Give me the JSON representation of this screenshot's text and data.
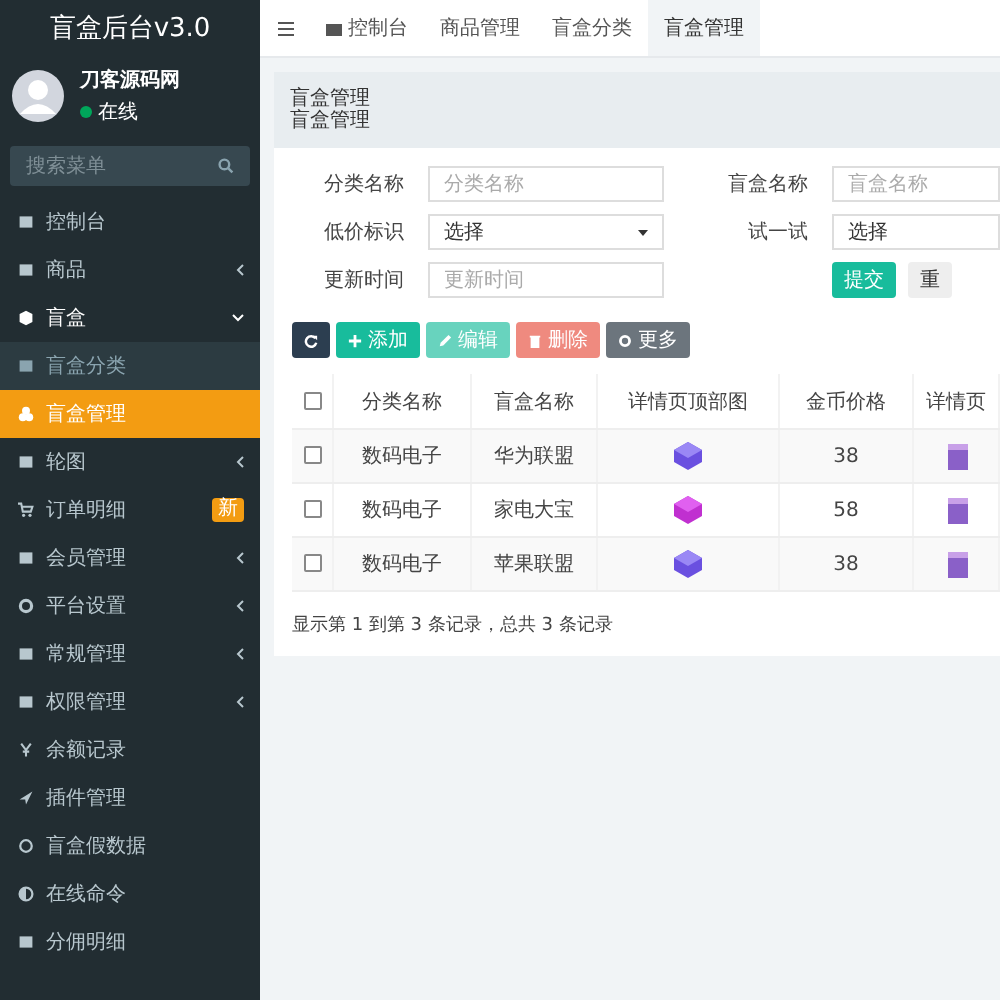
{
  "sidebar": {
    "title": "盲盒后台v3.0",
    "user": {
      "name": "刀客源码网",
      "status": "在线"
    },
    "search": {
      "placeholder": "搜索菜单"
    },
    "items": [
      {
        "label": "控制台",
        "kind": "link",
        "selected": false
      },
      {
        "label": "商品",
        "kind": "group",
        "selected": false,
        "expanded": false
      },
      {
        "label": "盲盒",
        "kind": "group",
        "selected": false,
        "expanded": true,
        "children": [
          {
            "label": "盲盒分类",
            "selected": false
          },
          {
            "label": "盲盒管理",
            "selected": true
          }
        ]
      },
      {
        "label": "轮图",
        "kind": "group",
        "selected": false,
        "expanded": false
      },
      {
        "label": "订单明细",
        "kind": "link",
        "selected": false,
        "badge": "新"
      },
      {
        "label": "会员管理",
        "kind": "group",
        "selected": false,
        "expanded": false
      },
      {
        "label": "平台设置",
        "kind": "group",
        "selected": false,
        "expanded": false
      },
      {
        "label": "常规管理",
        "kind": "group",
        "selected": false,
        "expanded": false
      },
      {
        "label": "权限管理",
        "kind": "group",
        "selected": false,
        "expanded": false
      },
      {
        "label": "余额记录",
        "kind": "link",
        "selected": false
      },
      {
        "label": "插件管理",
        "kind": "link",
        "selected": false
      },
      {
        "label": "盲盒假数据",
        "kind": "link",
        "selected": false
      },
      {
        "label": "在线命令",
        "kind": "link",
        "selected": false
      },
      {
        "label": "分佣明细",
        "kind": "link",
        "selected": false
      }
    ]
  },
  "tabs": [
    {
      "label": "控制台",
      "selected": false
    },
    {
      "label": "商品管理",
      "selected": false
    },
    {
      "label": "盲盒分类",
      "selected": false
    },
    {
      "label": "盲盒管理",
      "selected": true
    }
  ],
  "panel": {
    "title": "盲盒管理",
    "subtitle": "盲盒管理"
  },
  "form": {
    "rows": [
      [
        {
          "label": "分类名称",
          "kind": "input",
          "placeholder": "分类名称"
        },
        {
          "label": "盲盒名称",
          "kind": "input",
          "placeholder": "盲盒名称"
        }
      ],
      [
        {
          "label": "低价标识",
          "kind": "select",
          "value": "选择"
        },
        {
          "label": "试一试",
          "kind": "select",
          "value": "选择"
        }
      ],
      [
        {
          "label": "更新时间",
          "kind": "input",
          "placeholder": "更新时间"
        },
        {
          "kind": "buttons",
          "buttons": [
            "提交",
            "重"
          ]
        }
      ]
    ]
  },
  "toolbar": [
    {
      "kind": "refresh",
      "disabled": false
    },
    {
      "kind": "add",
      "label": "添加",
      "disabled": false
    },
    {
      "kind": "edit",
      "label": "编辑",
      "disabled": true
    },
    {
      "kind": "delete",
      "label": "删除",
      "disabled": true
    },
    {
      "kind": "more",
      "label": "更多",
      "disabled": false
    }
  ],
  "table": {
    "all_checked": false,
    "columns": [
      "分类名称",
      "盲盒名称",
      "详情页顶部图",
      "金币价格",
      "详情页"
    ],
    "rows": [
      {
        "checked": false,
        "category": "数码电子",
        "name": "华为联盟",
        "price": "38"
      },
      {
        "checked": false,
        "category": "数码电子",
        "name": "家电大宝",
        "price": "58"
      },
      {
        "checked": false,
        "category": "数码电子",
        "name": "苹果联盟",
        "price": "38"
      }
    ]
  },
  "footer": "显示第 1 到第 3 条记录，总共 3 条记录"
}
